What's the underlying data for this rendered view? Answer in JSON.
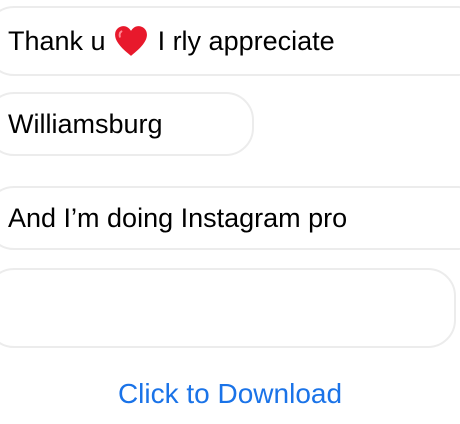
{
  "messages": [
    {
      "text_before": "Thank u",
      "icon": "red-heart-icon",
      "text_after": "I rly appreciate"
    },
    {
      "text": "Williamsburg"
    },
    {
      "text": "And I’m doing Instagram pro"
    },
    {
      "text": ""
    }
  ],
  "download": {
    "label": "Click to Download"
  },
  "colors": {
    "link": "#1a73e8",
    "heart": "#e8192c",
    "bubble_border": "#ececec"
  }
}
